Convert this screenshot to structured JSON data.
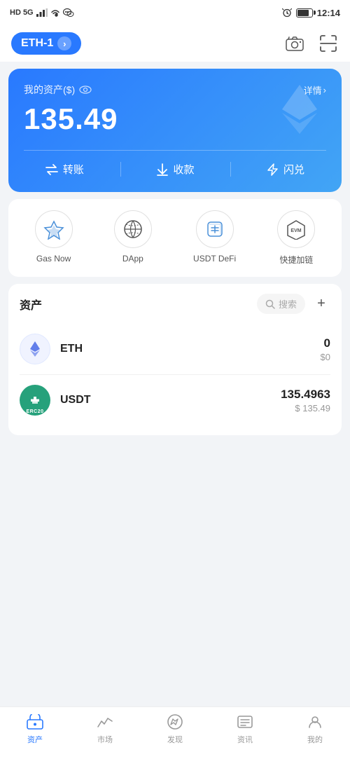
{
  "status": {
    "network": "HD 5G",
    "battery": "64",
    "time": "12:14",
    "signal_bars": "▌▌▌"
  },
  "header": {
    "wallet_name": "ETH-1",
    "camera_label": "camera",
    "scan_label": "scan"
  },
  "asset_card": {
    "label": "我的资产($)",
    "details": "详情",
    "details_arrow": "›",
    "amount": "135.49",
    "actions": [
      {
        "id": "transfer",
        "icon": "transfer",
        "label": "转账"
      },
      {
        "id": "receive",
        "icon": "receive",
        "label": "收款"
      },
      {
        "id": "flash",
        "icon": "flash",
        "label": "闪兑"
      }
    ]
  },
  "quick_menu": {
    "items": [
      {
        "id": "gas-now",
        "label": "Gas Now"
      },
      {
        "id": "dapp",
        "label": "DApp"
      },
      {
        "id": "usdt-defi",
        "label": "USDT DeFi"
      },
      {
        "id": "evm-chain",
        "label": "快捷加链"
      }
    ]
  },
  "assets_section": {
    "title": "资产",
    "search_placeholder": "搜索",
    "add_button": "+",
    "items": [
      {
        "id": "eth",
        "symbol": "ETH",
        "amount": "0",
        "usd": "$0",
        "color": "#627eea"
      },
      {
        "id": "usdt",
        "symbol": "USDT",
        "tag": "ERC20",
        "amount": "135.4963",
        "usd": "$ 135.49",
        "color": "#26a17b"
      }
    ]
  },
  "bottom_nav": {
    "items": [
      {
        "id": "assets",
        "label": "资产",
        "active": true
      },
      {
        "id": "market",
        "label": "市场",
        "active": false
      },
      {
        "id": "discover",
        "label": "发现",
        "active": false
      },
      {
        "id": "news",
        "label": "资讯",
        "active": false
      },
      {
        "id": "profile",
        "label": "我的",
        "active": false
      }
    ]
  }
}
